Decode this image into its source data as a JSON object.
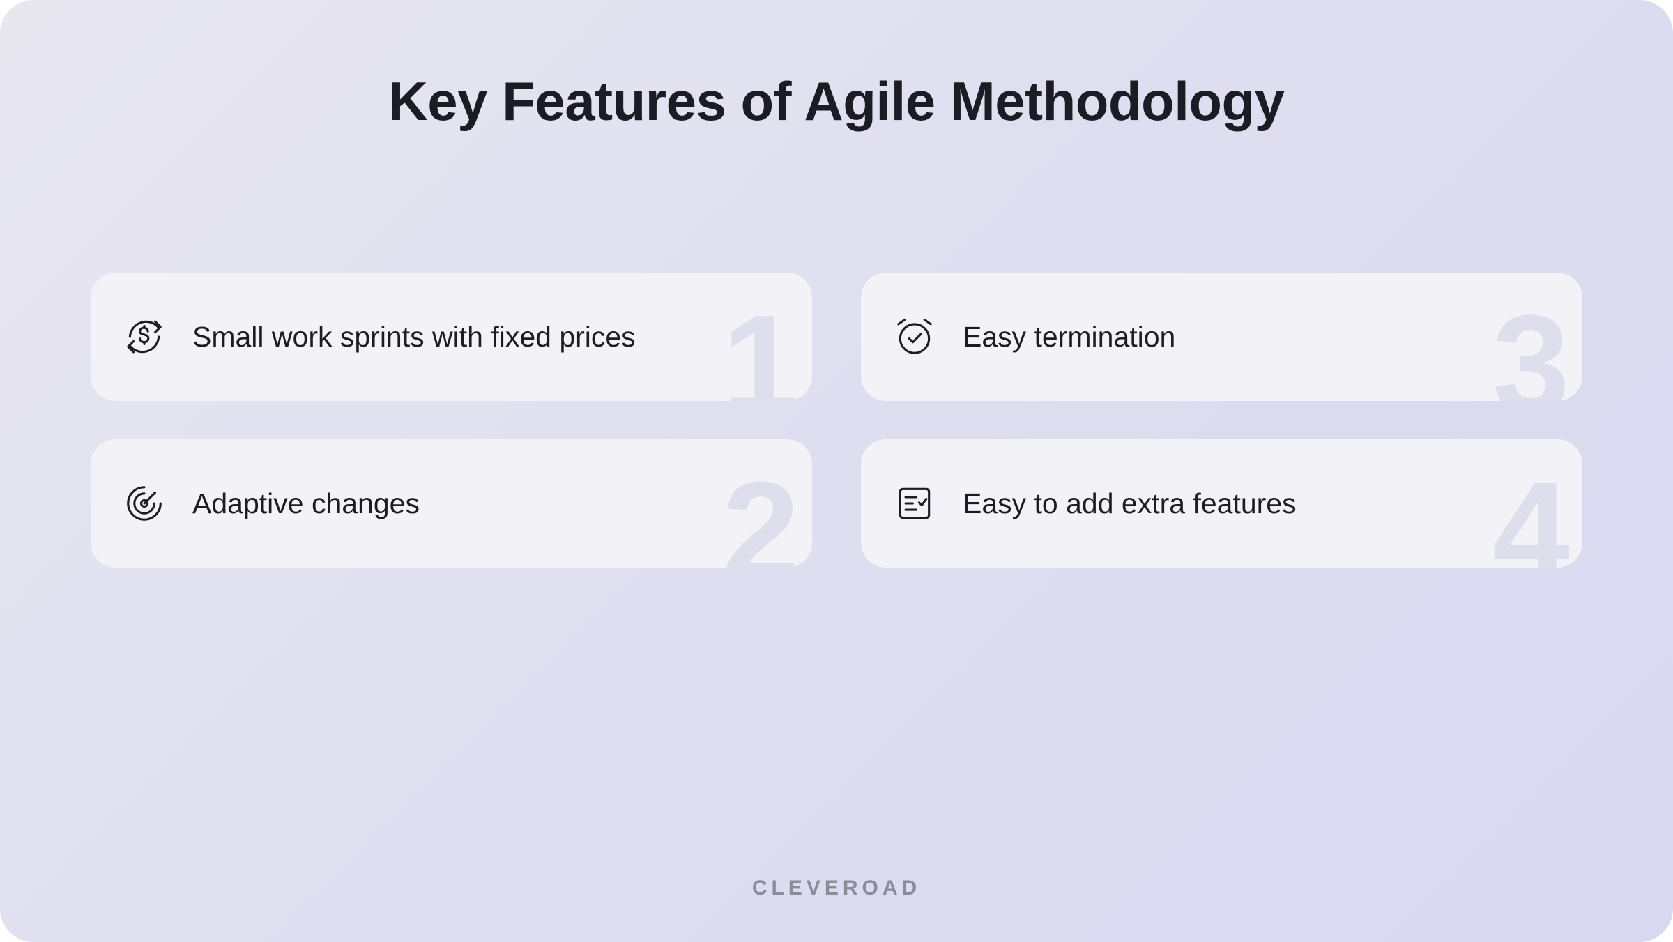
{
  "title": "Key Features of Agile Methodology",
  "features": [
    {
      "icon": "dollar-refresh-icon",
      "label": "Small work sprints with fixed prices",
      "number": "1"
    },
    {
      "icon": "target-icon",
      "label": "Adaptive changes",
      "number": "2"
    },
    {
      "icon": "alarm-check-icon",
      "label": "Easy termination",
      "number": "3"
    },
    {
      "icon": "checklist-icon",
      "label": "Easy to add extra features",
      "number": "4"
    }
  ],
  "footer": "CLEVEROAD"
}
